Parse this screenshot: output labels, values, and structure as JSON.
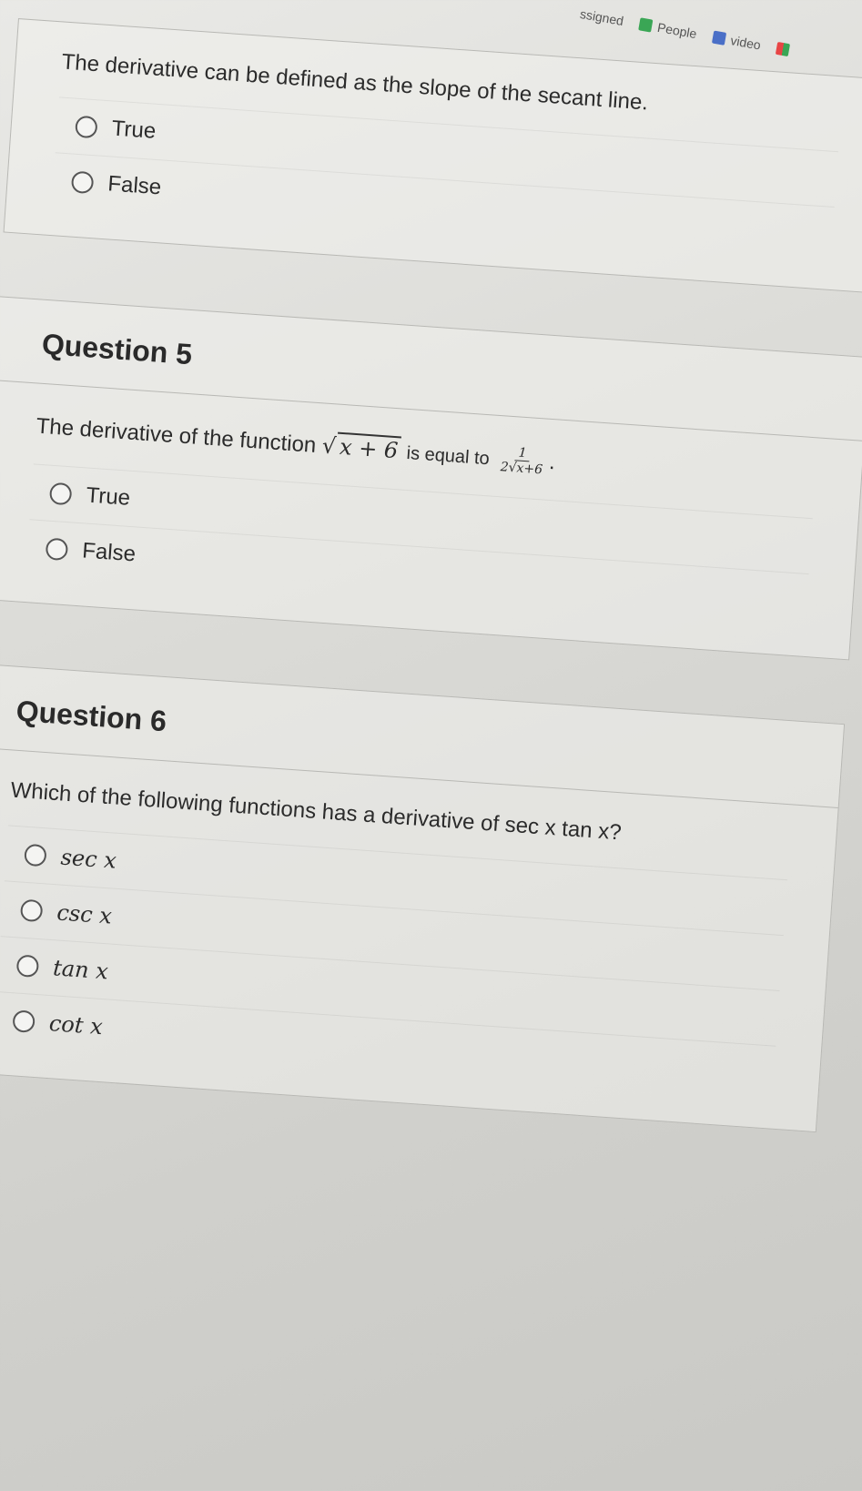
{
  "topbar": {
    "tab_assigned": "ssigned",
    "tab_people": "People",
    "tab_video": "video"
  },
  "question4": {
    "text": "The derivative can be defined as the slope of the secant line.",
    "options": [
      "True",
      "False"
    ]
  },
  "question5": {
    "title": "Question 5",
    "text_prefix": "The derivative of the function",
    "math_func": "x + 6",
    "text_mid": "is equal to",
    "frac_num": "1",
    "frac_den": "2√x+6",
    "text_end": ".",
    "options": [
      "True",
      "False"
    ]
  },
  "question6": {
    "title": "Question 6",
    "text": "Which of the following functions has a derivative of sec x tan x?",
    "options": [
      "sec x",
      "csc x",
      "tan x",
      "cot x"
    ]
  }
}
